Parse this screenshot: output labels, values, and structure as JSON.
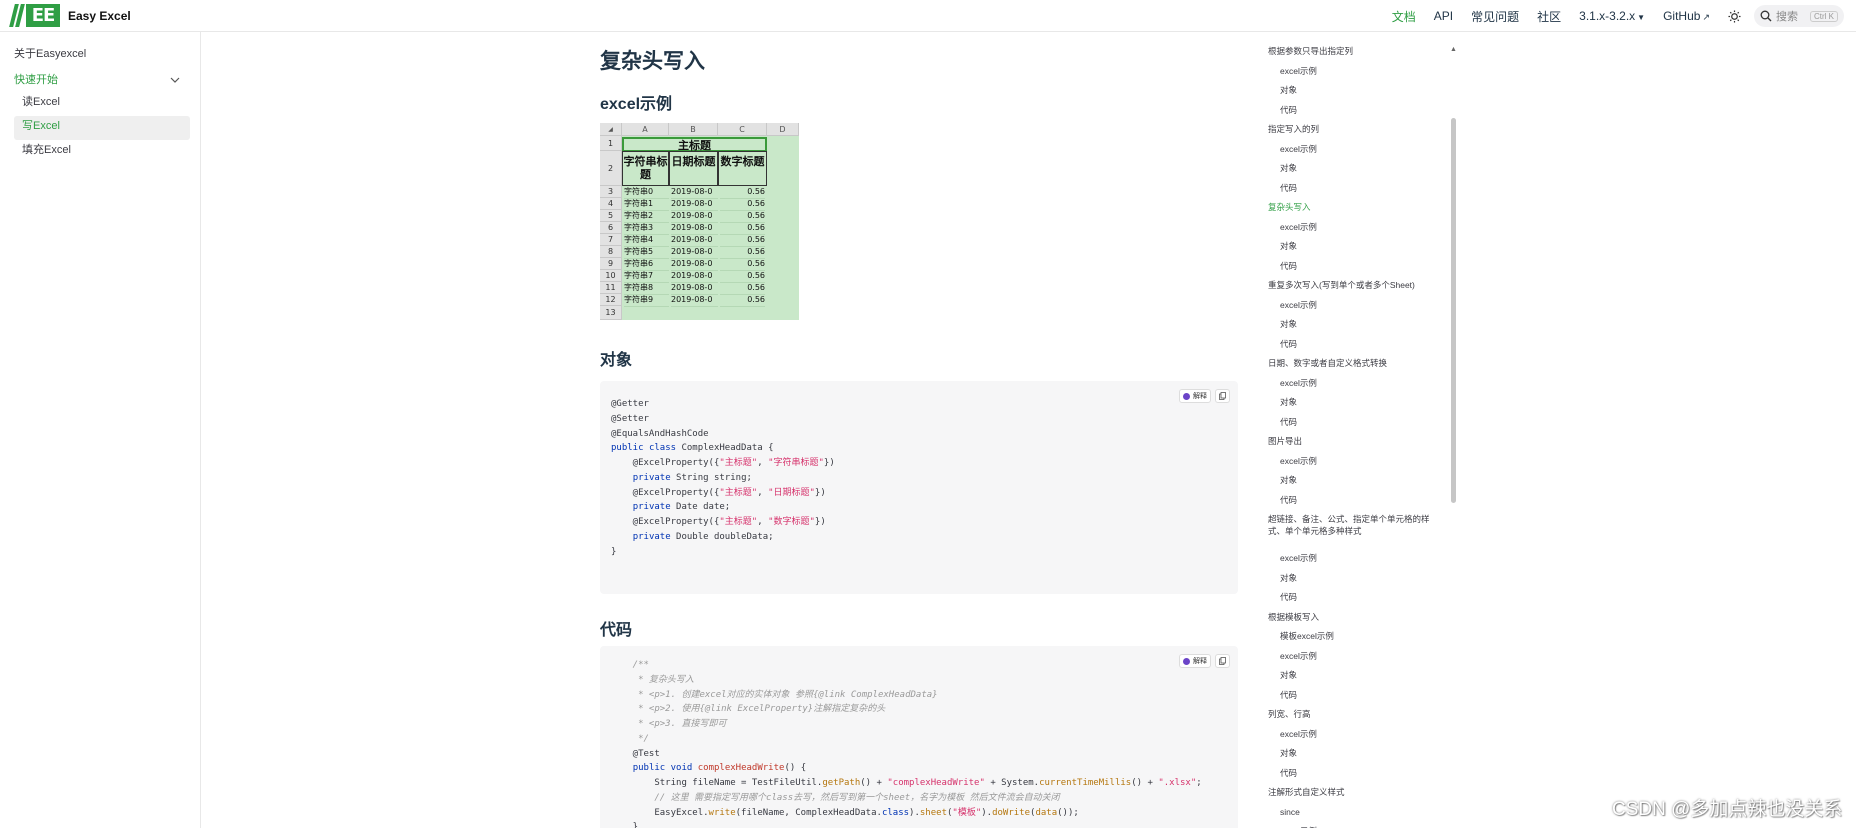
{
  "header": {
    "logo_mark": "EE",
    "brand": "Easy Excel",
    "nav": {
      "docs": "文档",
      "api": "API",
      "faq": "常见问题",
      "community": "社区",
      "version": "3.1.x-3.2.x",
      "github": "GitHub"
    },
    "search_placeholder": "搜索",
    "search_kbd": "Ctrl K"
  },
  "sidebar": {
    "about": "关于Easyexcel",
    "section": "快速开始",
    "items": [
      "读Excel",
      "写Excel",
      "填充Excel"
    ],
    "active_index": 1
  },
  "main": {
    "title": "复杂头写入",
    "h_excel": "excel示例",
    "h_object": "对象",
    "h_code": "代码",
    "excel": {
      "columns": [
        "A",
        "B",
        "C",
        "D"
      ],
      "main_header": "主标题",
      "sub_headers": [
        "字符串标题",
        "日期标题",
        "数字标题"
      ],
      "row_numbers": [
        "1",
        "2",
        "3",
        "4",
        "5",
        "6",
        "7",
        "8",
        "9",
        "10",
        "11",
        "12",
        "13"
      ],
      "rows": [
        [
          "字符串0",
          "2019-08-0",
          "0.56"
        ],
        [
          "字符串1",
          "2019-08-0",
          "0.56"
        ],
        [
          "字符串2",
          "2019-08-0",
          "0.56"
        ],
        [
          "字符串3",
          "2019-08-0",
          "0.56"
        ],
        [
          "字符串4",
          "2019-08-0",
          "0.56"
        ],
        [
          "字符串5",
          "2019-08-0",
          "0.56"
        ],
        [
          "字符串6",
          "2019-08-0",
          "0.56"
        ],
        [
          "字符串7",
          "2019-08-0",
          "0.56"
        ],
        [
          "字符串8",
          "2019-08-0",
          "0.56"
        ],
        [
          "字符串9",
          "2019-08-0",
          "0.56"
        ]
      ]
    },
    "code_tool_label": "解释",
    "object_code": [
      "@Getter",
      "@Setter",
      "@EqualsAndHashCode",
      "public class ComplexHeadData {",
      "    @ExcelProperty({\"主标题\", \"字符串标题\"})",
      "    private String string;",
      "    @ExcelProperty({\"主标题\", \"日期标题\"})",
      "    private Date date;",
      "    @ExcelProperty({\"主标题\", \"数字标题\"})",
      "    private Double doubleData;",
      "}"
    ],
    "method_code": [
      "    /**",
      "     * 复杂头写入",
      "     * <p>1. 创建excel对应的实体对象 参照{@link ComplexHeadData}",
      "     * <p>2. 使用{@link ExcelProperty}注解指定复杂的头",
      "     * <p>3. 直接写即可",
      "     */",
      "    @Test",
      "    public void complexHeadWrite() {",
      "        String fileName = TestFileUtil.getPath() + \"complexHeadWrite\" + System.currentTimeMillis() + \".xlsx\";",
      "        // 这里 需要指定写用哪个class去写，然后写到第一个sheet，名字为模板 然后文件流会自动关闭",
      "        EasyExcel.write(fileName, ComplexHeadData.class).sheet(\"模板\").doWrite(data());",
      "    }"
    ]
  },
  "outline": [
    {
      "label": "根据参数只导出指定列",
      "child": false
    },
    {
      "label": "excel示例",
      "child": true
    },
    {
      "label": "对象",
      "child": true
    },
    {
      "label": "代码",
      "child": true
    },
    {
      "label": "指定写入的列",
      "child": false
    },
    {
      "label": "excel示例",
      "child": true
    },
    {
      "label": "对象",
      "child": true
    },
    {
      "label": "代码",
      "child": true
    },
    {
      "label": "复杂头写入",
      "child": false,
      "active": true
    },
    {
      "label": "excel示例",
      "child": true
    },
    {
      "label": "对象",
      "child": true
    },
    {
      "label": "代码",
      "child": true
    },
    {
      "label": "重复多次写入(写到单个或者多个Sheet)",
      "child": false
    },
    {
      "label": "excel示例",
      "child": true
    },
    {
      "label": "对象",
      "child": true
    },
    {
      "label": "代码",
      "child": true
    },
    {
      "label": "日期、数字或者自定义格式转换",
      "child": false
    },
    {
      "label": "excel示例",
      "child": true
    },
    {
      "label": "对象",
      "child": true
    },
    {
      "label": "代码",
      "child": true
    },
    {
      "label": "图片导出",
      "child": false
    },
    {
      "label": "excel示例",
      "child": true
    },
    {
      "label": "对象",
      "child": true
    },
    {
      "label": "代码",
      "child": true
    },
    {
      "label": "超链接、备注、公式、指定单个单元格的样式、单个单元格多种样式",
      "child": false,
      "wrap": true
    },
    {
      "label": "excel示例",
      "child": true
    },
    {
      "label": "对象",
      "child": true
    },
    {
      "label": "代码",
      "child": true
    },
    {
      "label": "根据模板写入",
      "child": false
    },
    {
      "label": "模板excel示例",
      "child": true
    },
    {
      "label": "excel示例",
      "child": true
    },
    {
      "label": "对象",
      "child": true
    },
    {
      "label": "代码",
      "child": true
    },
    {
      "label": "列宽、行高",
      "child": false
    },
    {
      "label": "excel示例",
      "child": true
    },
    {
      "label": "对象",
      "child": true
    },
    {
      "label": "代码",
      "child": true
    },
    {
      "label": "注解形式自定义样式",
      "child": false
    },
    {
      "label": "since",
      "child": true
    },
    {
      "label": "excel示例",
      "child": true
    }
  ],
  "watermark": "CSDN @多加点辣也没关系",
  "colors": {
    "accent": "#2f9e44",
    "code_bg": "#f6f6f7",
    "excel_fill": "#c9e8c9"
  }
}
